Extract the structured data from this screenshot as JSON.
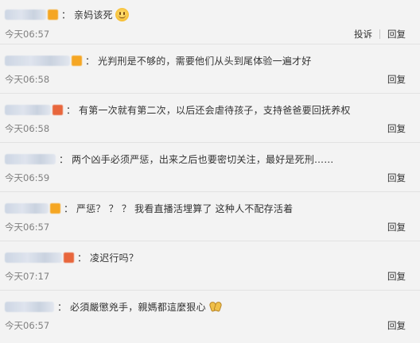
{
  "comments": [
    {
      "text": "亲妈该死",
      "time": "今天06:57",
      "report_label": "投诉",
      "reply_label": "回复",
      "emoji": "smile-face-icon",
      "badge_color": "#f5a623"
    },
    {
      "text": "光判刑是不够的，需要他们从头到尾体验一遍才好",
      "time": "今天06:58",
      "reply_label": "回复",
      "badge_color": "#f5a623"
    },
    {
      "text": "有第一次就有第二次，以后还会虐待孩子，支持爸爸要回抚养权",
      "time": "今天06:58",
      "reply_label": "回复",
      "badge_color": "#e8663c"
    },
    {
      "text": "两个凶手必须严惩，出来之后也要密切关注，最好是死刑……",
      "time": "今天06:59",
      "reply_label": "回复"
    },
    {
      "text": "严惩？ ？ ？ 我看直播活埋算了 这种人不配存活着",
      "time": "今天06:57",
      "reply_label": "回复",
      "badge_color": "#f5a623"
    },
    {
      "text": "凌迟行吗？",
      "time": "今天07:17",
      "reply_label": "回复",
      "badge_color": "#e8663c"
    },
    {
      "text": "必須嚴懲兇手，親媽都這麼狠心",
      "time": "今天06:57",
      "reply_label": "回复",
      "emoji": "clapping-hands-icon"
    }
  ]
}
